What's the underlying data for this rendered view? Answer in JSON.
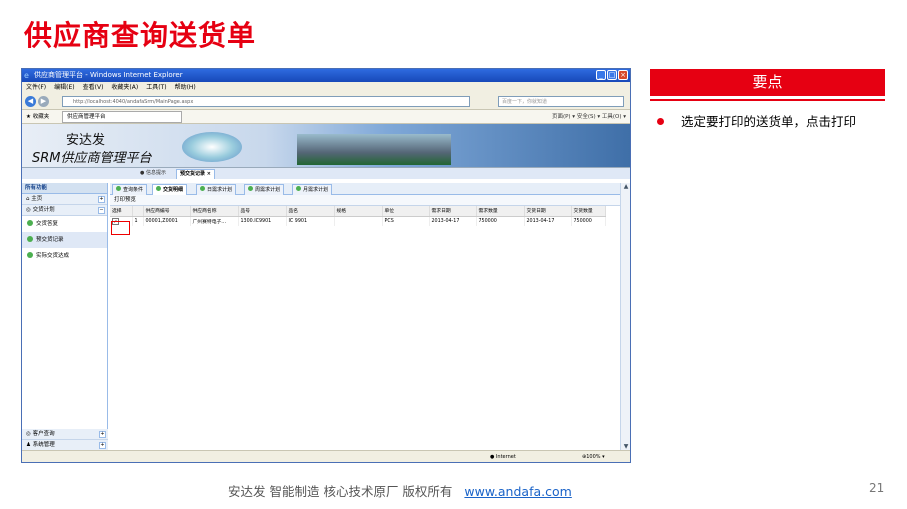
{
  "slide": {
    "title": "供应商查询送货单",
    "panel_heading": "要点",
    "bullet_text": "选定要打印的送货单，点击打印",
    "footer_text": "安达发   智能制造 核心技术原厂   版权所有",
    "footer_link": "www.andafa.com",
    "page_number": "21",
    "accent_color": "#e60012"
  },
  "browser": {
    "window_title": "供应商管理平台 - Windows Internet Explorer",
    "menu": [
      "文件(F)",
      "编辑(E)",
      "查看(V)",
      "收藏夹(A)",
      "工具(T)",
      "帮助(H)"
    ],
    "url": "http://localhost:4040/andafaSrm/MainPage.aspx",
    "search_placeholder": "百度一下，你就知道",
    "favorites_label": "收藏夹",
    "page_tab": "供应商管理平台",
    "tools_text": "页面(P) ▾  安全(S) ▾  工具(O) ▾",
    "status_zone": "Internet",
    "zoom": "100%"
  },
  "app": {
    "banner_line1": "安达发",
    "banner_line2": "SRM供应商管理平台",
    "top_tabs": [
      "信息提示",
      "预交货记录"
    ],
    "sidebar_header": "所有功能",
    "sidebar_groups": [
      "主页",
      "交货计划"
    ],
    "sidebar_items": [
      "交货答复",
      "预交货记录",
      "实际交货达成"
    ],
    "sidebar_bottom": [
      "客户查询",
      "系统管理"
    ],
    "sub_tabs": [
      "查询条件",
      "交货明细",
      "日需求计划",
      "周需求计划",
      "月需求计划"
    ],
    "toolbar_label": "打印预览",
    "table": {
      "columns": [
        "选择",
        "",
        "供应商编号",
        "供应商名称",
        "品号",
        "品名",
        "规格",
        "单位",
        "需求日期",
        "需求数量",
        "交货日期",
        "交货数量"
      ],
      "rows": [
        [
          "✓",
          "1",
          "00001,Z0001",
          "广州赛特电子…",
          "1300.IC9901",
          "IC 9901",
          "",
          "PCS",
          "2013-04-17",
          "750000",
          "2013-04-17",
          "750000"
        ]
      ]
    }
  }
}
